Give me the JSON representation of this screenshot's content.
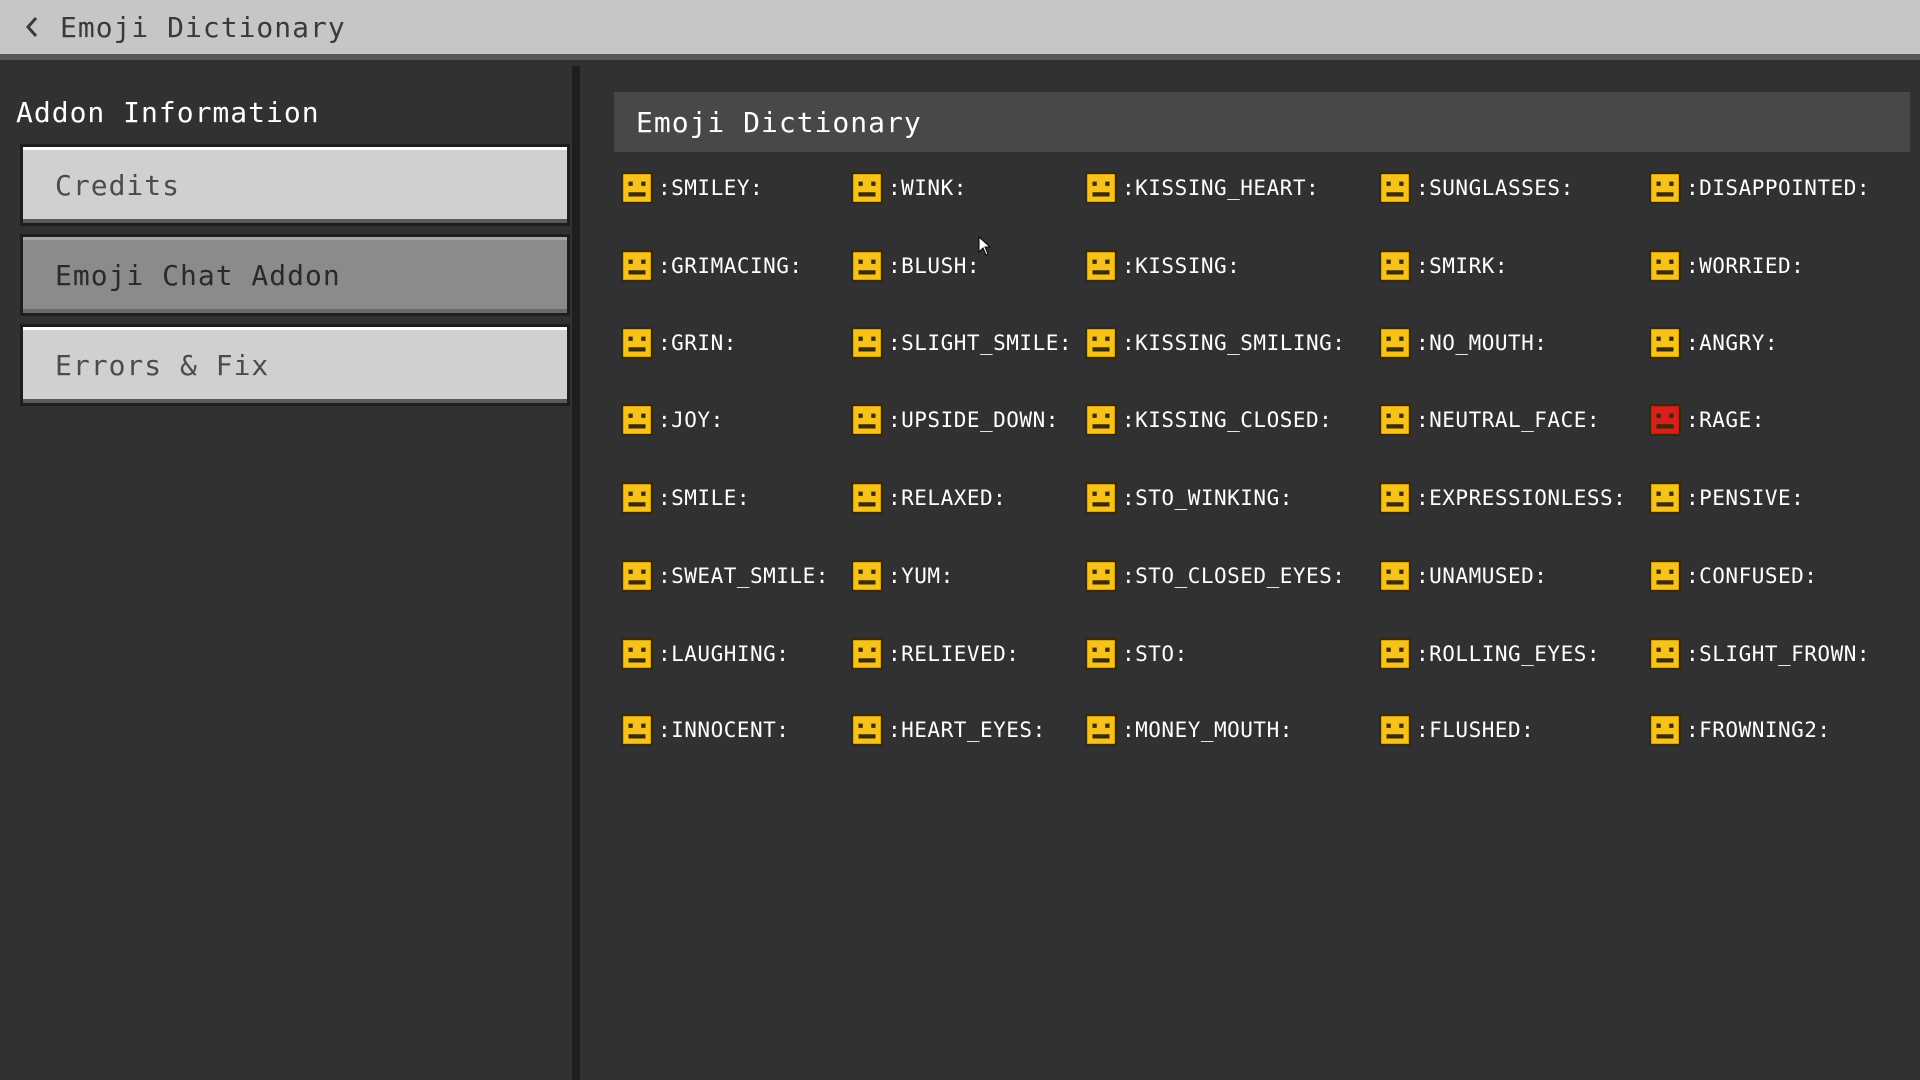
{
  "header": {
    "title": "Emoji Dictionary"
  },
  "sidebar": {
    "heading": "Addon Information",
    "items": [
      {
        "label": "Credits",
        "state": "normal"
      },
      {
        "label": "Emoji Chat Addon",
        "state": "active"
      },
      {
        "label": "Errors & Fix",
        "state": "normal"
      }
    ]
  },
  "main": {
    "heading": "Emoji Dictionary",
    "emojis": [
      [
        ":SMILEY:",
        ":WINK:",
        ":KISSING_HEART:",
        ":SUNGLASSES:",
        ":DISAPPOINTED:"
      ],
      [
        ":GRIMACING:",
        ":BLUSH:",
        ":KISSING:",
        ":SMIRK:",
        ":WORRIED:"
      ],
      [
        ":GRIN:",
        ":SLIGHT_SMILE:",
        ":KISSING_SMILING:",
        ":NO_MOUTH:",
        ":ANGRY:"
      ],
      [
        ":JOY:",
        ":UPSIDE_DOWN:",
        ":KISSING_CLOSED:",
        ":NEUTRAL_FACE:",
        ":RAGE:"
      ],
      [
        ":SMILE:",
        ":RELAXED:",
        ":STO_WINKING:",
        ":EXPRESSIONLESS:",
        ":PENSIVE:"
      ],
      [
        ":SWEAT_SMILE:",
        ":YUM:",
        ":STO_CLOSED_EYES:",
        ":UNAMUSED:",
        ":CONFUSED:"
      ],
      [
        ":LAUGHING:",
        ":RELIEVED:",
        ":STO:",
        ":ROLLING_EYES:",
        ":SLIGHT_FROWN:"
      ],
      [
        ":INNOCENT:",
        ":HEART_EYES:",
        ":MONEY_MOUTH:",
        ":FLUSHED:",
        ":FROWNING2:"
      ]
    ]
  },
  "colors": {
    "emoji_yellow": "#f7c21a",
    "emoji_red": "#d81e1e",
    "titlebar_bg": "#c6c6c6",
    "panel_bg": "#313133"
  }
}
